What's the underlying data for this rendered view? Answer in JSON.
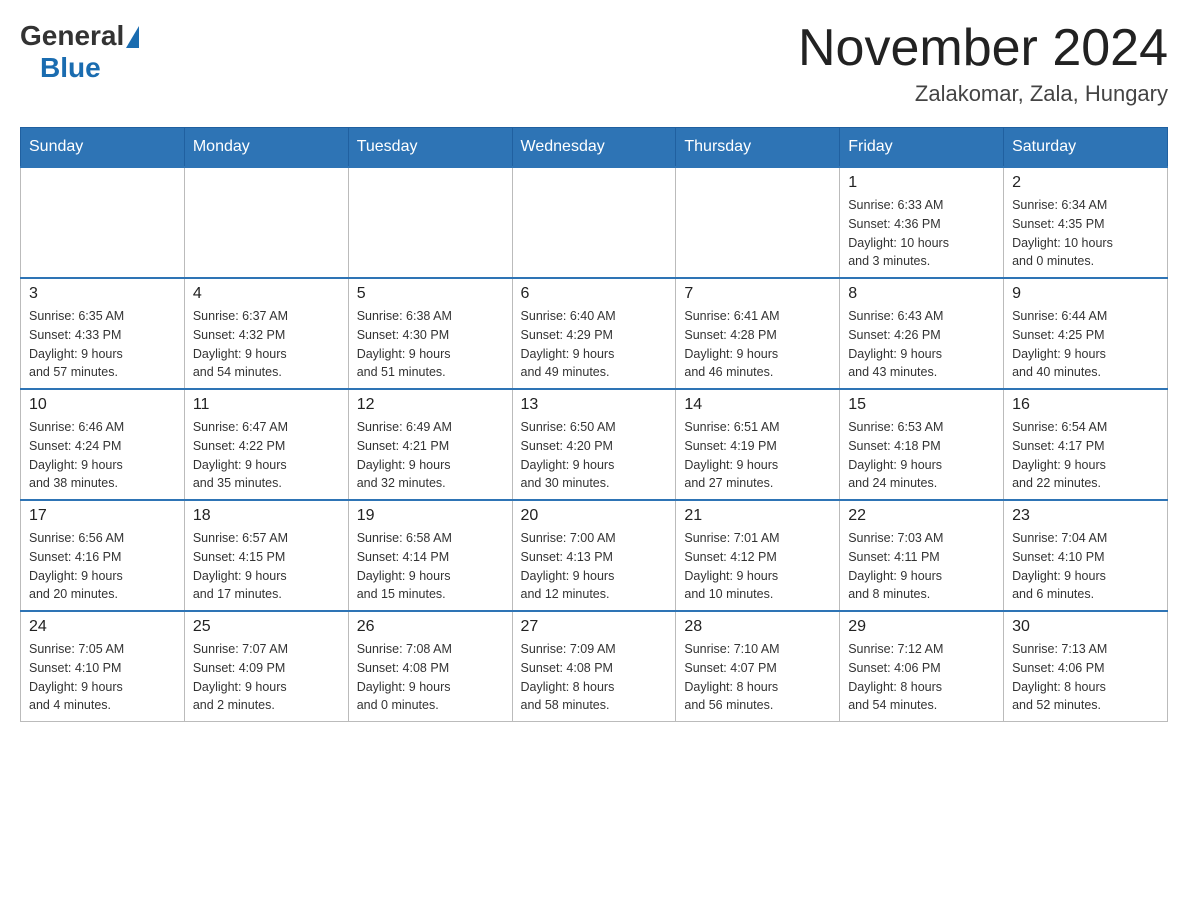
{
  "header": {
    "logo": {
      "text_general": "General",
      "text_blue": "Blue",
      "triangle_unicode": "▲"
    },
    "title": "November 2024",
    "location": "Zalakomar, Zala, Hungary"
  },
  "calendar": {
    "days_of_week": [
      "Sunday",
      "Monday",
      "Tuesday",
      "Wednesday",
      "Thursday",
      "Friday",
      "Saturday"
    ],
    "weeks": [
      [
        {
          "day": "",
          "info": ""
        },
        {
          "day": "",
          "info": ""
        },
        {
          "day": "",
          "info": ""
        },
        {
          "day": "",
          "info": ""
        },
        {
          "day": "",
          "info": ""
        },
        {
          "day": "1",
          "info": "Sunrise: 6:33 AM\nSunset: 4:36 PM\nDaylight: 10 hours\nand 3 minutes."
        },
        {
          "day": "2",
          "info": "Sunrise: 6:34 AM\nSunset: 4:35 PM\nDaylight: 10 hours\nand 0 minutes."
        }
      ],
      [
        {
          "day": "3",
          "info": "Sunrise: 6:35 AM\nSunset: 4:33 PM\nDaylight: 9 hours\nand 57 minutes."
        },
        {
          "day": "4",
          "info": "Sunrise: 6:37 AM\nSunset: 4:32 PM\nDaylight: 9 hours\nand 54 minutes."
        },
        {
          "day": "5",
          "info": "Sunrise: 6:38 AM\nSunset: 4:30 PM\nDaylight: 9 hours\nand 51 minutes."
        },
        {
          "day": "6",
          "info": "Sunrise: 6:40 AM\nSunset: 4:29 PM\nDaylight: 9 hours\nand 49 minutes."
        },
        {
          "day": "7",
          "info": "Sunrise: 6:41 AM\nSunset: 4:28 PM\nDaylight: 9 hours\nand 46 minutes."
        },
        {
          "day": "8",
          "info": "Sunrise: 6:43 AM\nSunset: 4:26 PM\nDaylight: 9 hours\nand 43 minutes."
        },
        {
          "day": "9",
          "info": "Sunrise: 6:44 AM\nSunset: 4:25 PM\nDaylight: 9 hours\nand 40 minutes."
        }
      ],
      [
        {
          "day": "10",
          "info": "Sunrise: 6:46 AM\nSunset: 4:24 PM\nDaylight: 9 hours\nand 38 minutes."
        },
        {
          "day": "11",
          "info": "Sunrise: 6:47 AM\nSunset: 4:22 PM\nDaylight: 9 hours\nand 35 minutes."
        },
        {
          "day": "12",
          "info": "Sunrise: 6:49 AM\nSunset: 4:21 PM\nDaylight: 9 hours\nand 32 minutes."
        },
        {
          "day": "13",
          "info": "Sunrise: 6:50 AM\nSunset: 4:20 PM\nDaylight: 9 hours\nand 30 minutes."
        },
        {
          "day": "14",
          "info": "Sunrise: 6:51 AM\nSunset: 4:19 PM\nDaylight: 9 hours\nand 27 minutes."
        },
        {
          "day": "15",
          "info": "Sunrise: 6:53 AM\nSunset: 4:18 PM\nDaylight: 9 hours\nand 24 minutes."
        },
        {
          "day": "16",
          "info": "Sunrise: 6:54 AM\nSunset: 4:17 PM\nDaylight: 9 hours\nand 22 minutes."
        }
      ],
      [
        {
          "day": "17",
          "info": "Sunrise: 6:56 AM\nSunset: 4:16 PM\nDaylight: 9 hours\nand 20 minutes."
        },
        {
          "day": "18",
          "info": "Sunrise: 6:57 AM\nSunset: 4:15 PM\nDaylight: 9 hours\nand 17 minutes."
        },
        {
          "day": "19",
          "info": "Sunrise: 6:58 AM\nSunset: 4:14 PM\nDaylight: 9 hours\nand 15 minutes."
        },
        {
          "day": "20",
          "info": "Sunrise: 7:00 AM\nSunset: 4:13 PM\nDaylight: 9 hours\nand 12 minutes."
        },
        {
          "day": "21",
          "info": "Sunrise: 7:01 AM\nSunset: 4:12 PM\nDaylight: 9 hours\nand 10 minutes."
        },
        {
          "day": "22",
          "info": "Sunrise: 7:03 AM\nSunset: 4:11 PM\nDaylight: 9 hours\nand 8 minutes."
        },
        {
          "day": "23",
          "info": "Sunrise: 7:04 AM\nSunset: 4:10 PM\nDaylight: 9 hours\nand 6 minutes."
        }
      ],
      [
        {
          "day": "24",
          "info": "Sunrise: 7:05 AM\nSunset: 4:10 PM\nDaylight: 9 hours\nand 4 minutes."
        },
        {
          "day": "25",
          "info": "Sunrise: 7:07 AM\nSunset: 4:09 PM\nDaylight: 9 hours\nand 2 minutes."
        },
        {
          "day": "26",
          "info": "Sunrise: 7:08 AM\nSunset: 4:08 PM\nDaylight: 9 hours\nand 0 minutes."
        },
        {
          "day": "27",
          "info": "Sunrise: 7:09 AM\nSunset: 4:08 PM\nDaylight: 8 hours\nand 58 minutes."
        },
        {
          "day": "28",
          "info": "Sunrise: 7:10 AM\nSunset: 4:07 PM\nDaylight: 8 hours\nand 56 minutes."
        },
        {
          "day": "29",
          "info": "Sunrise: 7:12 AM\nSunset: 4:06 PM\nDaylight: 8 hours\nand 54 minutes."
        },
        {
          "day": "30",
          "info": "Sunrise: 7:13 AM\nSunset: 4:06 PM\nDaylight: 8 hours\nand 52 minutes."
        }
      ]
    ]
  }
}
